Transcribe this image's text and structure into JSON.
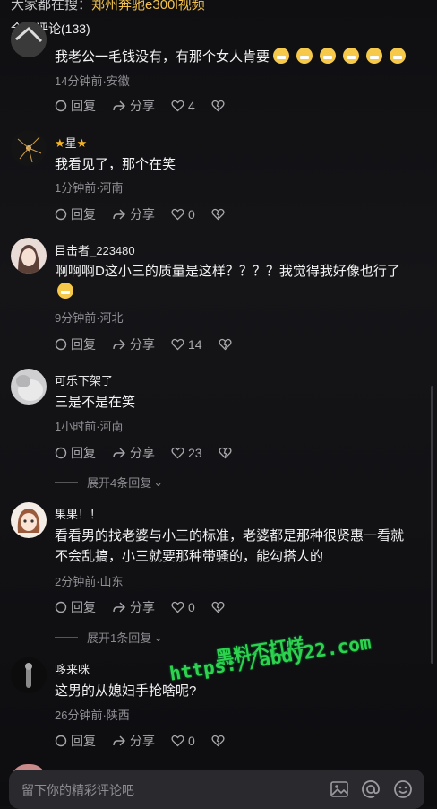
{
  "header": {
    "search_prefix": "大家都在搜：",
    "search_keyword": "郑州奔驰e300l视频",
    "comment_count": "全部评论(133)"
  },
  "comments": [
    {
      "text": "我老公一毛钱没有，有那个女人肯要",
      "meta": "14分钟前·安徽",
      "reply": "回复",
      "share": "分享",
      "likes": "4"
    },
    {
      "author": "星",
      "text": "我看见了，那个在笑",
      "meta": "1分钟前·河南",
      "reply": "回复",
      "share": "分享",
      "likes": "0"
    },
    {
      "author": "目击者_223480",
      "text": "啊啊啊D这小三的质量是这样？？？？我觉得我好像也行了",
      "meta": "9分钟前·河北",
      "reply": "回复",
      "share": "分享",
      "likes": "14"
    },
    {
      "author": "可乐下架了",
      "text": "三是不是在笑",
      "meta": "1小时前·河南",
      "reply": "回复",
      "share": "分享",
      "likes": "23",
      "expand": "展开4条回复"
    },
    {
      "author": "果果！！",
      "text": "看看男的找老婆与小三的标准，老婆都是那种很贤惠一看就不会乱搞，小三就要那种带骚的，能勾搭人的",
      "meta": "2分钟前·山东",
      "reply": "回复",
      "share": "分享",
      "likes": "0",
      "expand": "展开1条回复"
    },
    {
      "author": "哆来咪",
      "text": "这男的从媳妇手抢啥呢?",
      "meta": "26分钟前·陕西",
      "reply": "回复",
      "share": "分享",
      "likes": "0"
    }
  ],
  "input": {
    "placeholder": "留下你的精彩评论吧"
  },
  "watermark": {
    "line1": "黑料不打烊",
    "line2": "https://abdy22.com"
  },
  "colors": {
    "keyword": "#f2c14e",
    "watermark": "#2fd24e",
    "background": "#121215"
  }
}
